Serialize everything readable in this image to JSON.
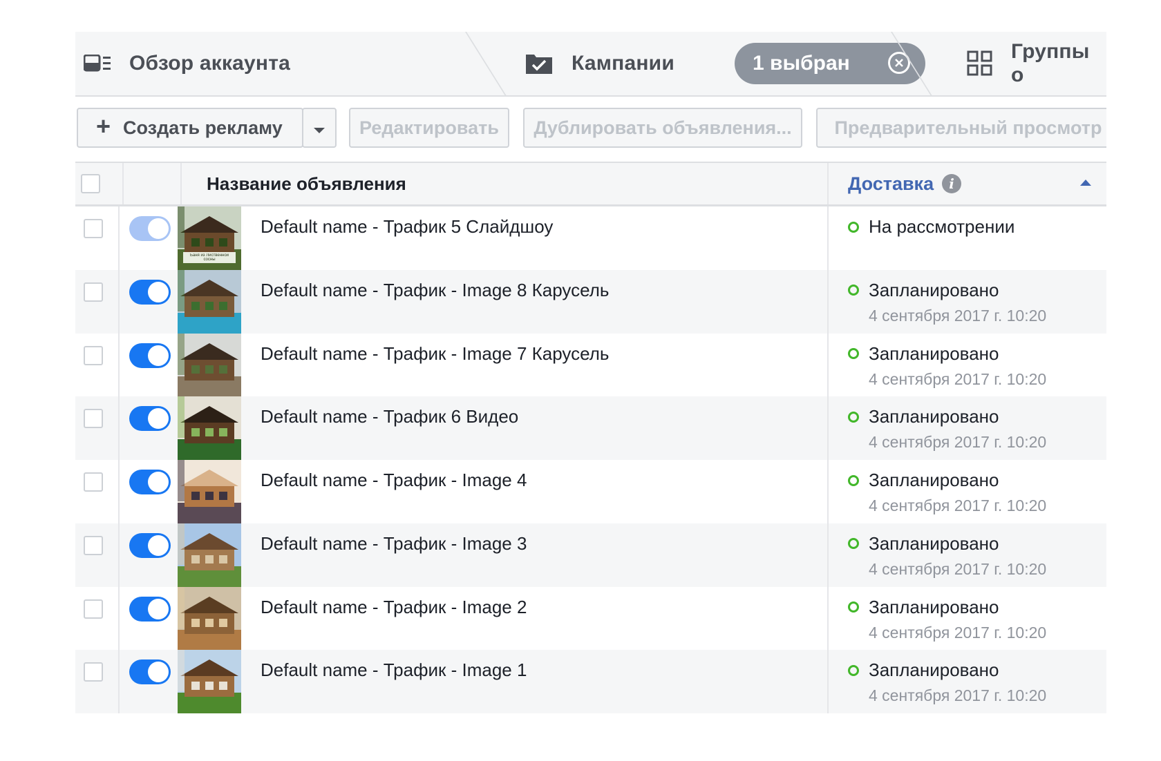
{
  "tabs": {
    "overview": "Обзор аккаунта",
    "campaigns": "Кампании",
    "selected_pill": "1 выбран",
    "groups": "Группы о"
  },
  "toolbar": {
    "create": "Создать рекламу",
    "edit": "Редактировать",
    "duplicate": "Дублировать объявления...",
    "preview": "Предварительный просмотр"
  },
  "table": {
    "col_name": "Название объявления",
    "col_delivery": "Доставка",
    "rows": [
      {
        "name": "Default name - Трафик 5 Слайдшоу",
        "status": "На рассмотрении",
        "date": "",
        "toggle_on": true,
        "toggle_dim": true,
        "thumb_caption": "Баня из Лиственной сосны"
      },
      {
        "name": "Default name - Трафик - Image 8 Карусель",
        "status": "Запланировано",
        "date": "4 сентября 2017 г. 10:20",
        "toggle_on": true,
        "toggle_dim": false
      },
      {
        "name": "Default name - Трафик - Image 7 Карусель",
        "status": "Запланировано",
        "date": "4 сентября 2017 г. 10:20",
        "toggle_on": true,
        "toggle_dim": false
      },
      {
        "name": "Default name - Трафик 6 Видео",
        "status": "Запланировано",
        "date": "4 сентября 2017 г. 10:20",
        "toggle_on": true,
        "toggle_dim": false
      },
      {
        "name": "Default name - Трафик - Image 4",
        "status": "Запланировано",
        "date": "4 сентября 2017 г. 10:20",
        "toggle_on": true,
        "toggle_dim": false
      },
      {
        "name": "Default name - Трафик - Image 3",
        "status": "Запланировано",
        "date": "4 сентября 2017 г. 10:20",
        "toggle_on": true,
        "toggle_dim": false
      },
      {
        "name": "Default name - Трафик - Image 2",
        "status": "Запланировано",
        "date": "4 сентября 2017 г. 10:20",
        "toggle_on": true,
        "toggle_dim": false
      },
      {
        "name": "Default name - Трафик - Image 1",
        "status": "Запланировано",
        "date": "4 сентября 2017 г. 10:20",
        "toggle_on": true,
        "toggle_dim": false
      }
    ]
  },
  "colors": {
    "accent": "#4267b2",
    "toggle_on": "#1877f2",
    "toggle_dim": "#a8c4f5",
    "status_dot": "#42b72a",
    "pill_bg": "#8d949e"
  },
  "icons": {
    "overview": "account-overview-icon",
    "campaigns": "checkbox-folder-icon",
    "groups": "grid-icon",
    "pill_close": "close-circle-icon",
    "create_plus": "plus-icon",
    "dropdown": "caret-down-icon",
    "info": "info-icon",
    "sort": "sort-ascending-icon"
  }
}
